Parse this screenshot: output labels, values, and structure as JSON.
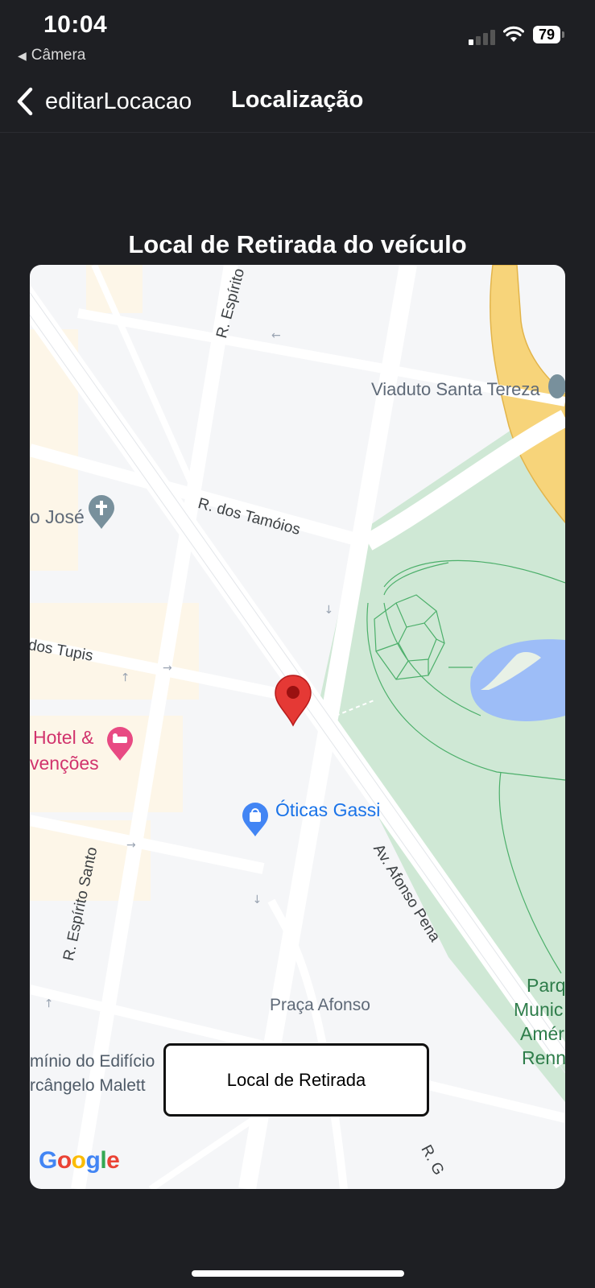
{
  "status": {
    "time": "10:04",
    "back_app": "Câmera",
    "battery": "79"
  },
  "nav": {
    "back_label": "editarLocacao",
    "title": "Localização"
  },
  "page": {
    "section_title": "Local de Retirada do veículo"
  },
  "map": {
    "labels": {
      "viaduto": "Viaduto Santa Tereza",
      "tamoios": "R. dos Tamóios",
      "espirito_top": "R. Espírito",
      "sao_jose": "o José",
      "tupis": "dos Tupis",
      "hotel_line1": "Hotel &",
      "hotel_line2": "venções",
      "oticas": "Óticas Gassi",
      "afonso_pena": "Av. Afonso Pena",
      "espirito_santo": "R. Espírito Santo",
      "praca": "Praça Afonso",
      "condominio_line1": "mínio do Edifício",
      "condominio_line2": "rcângelo Malett",
      "parque_line1": "Parq",
      "parque_line2": "Munic",
      "parque_line3": "Amér",
      "parque_line4": "Renn",
      "rg": "R. G"
    },
    "callout": "Local de Retirada",
    "attribution": [
      "G",
      "o",
      "o",
      "g",
      "l",
      "e"
    ],
    "colors": {
      "pin": "#e53935",
      "park": "#cfe8d5",
      "water": "#9dbdf7",
      "highway": "#f7d47a",
      "pink_poi": "#e84a83",
      "blue_poi": "#4285f4",
      "religious_poi": "#78909c"
    }
  }
}
